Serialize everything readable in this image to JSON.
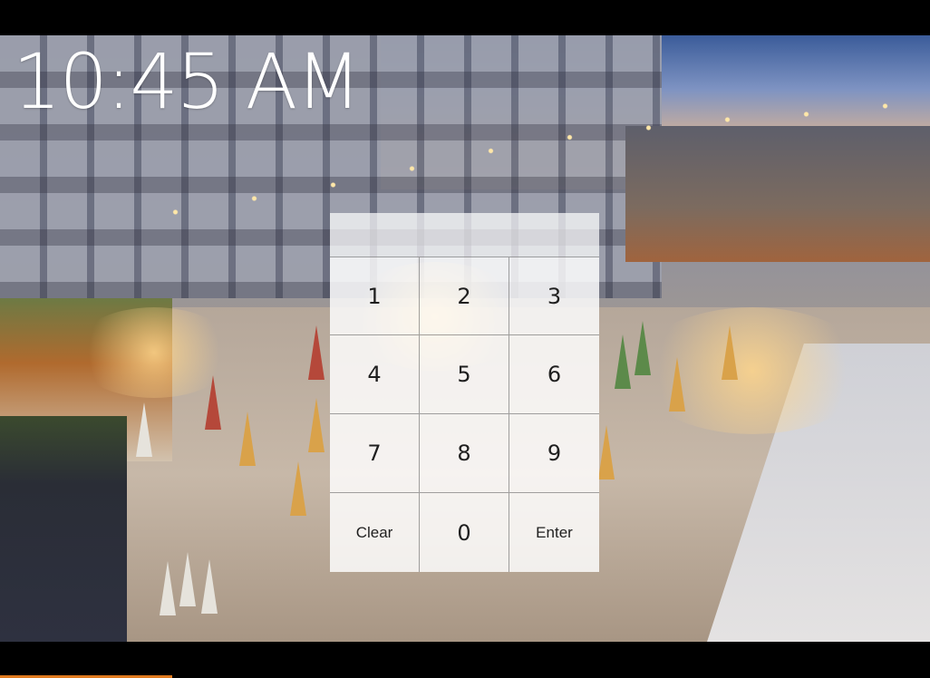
{
  "clock": {
    "time": "10:45 AM"
  },
  "keypad": {
    "display_value": "",
    "keys": [
      {
        "label": "1"
      },
      {
        "label": "2"
      },
      {
        "label": "3"
      },
      {
        "label": "4"
      },
      {
        "label": "5"
      },
      {
        "label": "6"
      },
      {
        "label": "7"
      },
      {
        "label": "8"
      },
      {
        "label": "9"
      },
      {
        "label": "Clear"
      },
      {
        "label": "0"
      },
      {
        "label": "Enter"
      }
    ]
  },
  "colors": {
    "background": "#000000",
    "clock_text": "#ffffff",
    "key_text": "#1f1f1f",
    "accent_strip": "#e07a1f"
  }
}
